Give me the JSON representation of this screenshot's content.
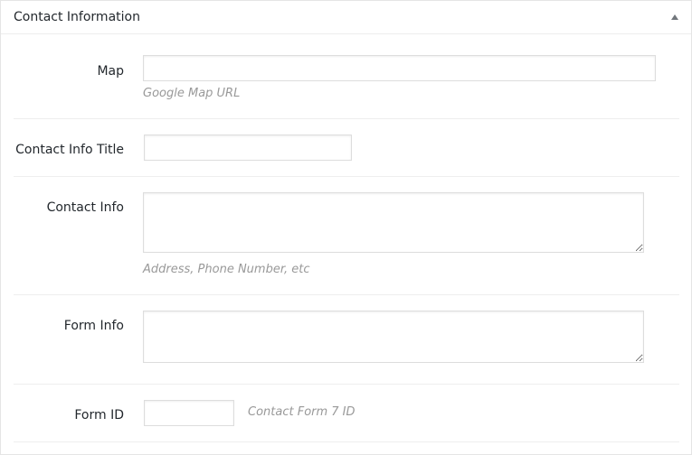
{
  "panel": {
    "title": "Contact Information"
  },
  "fields": {
    "map": {
      "label": "Map",
      "value": "",
      "description": "Google Map URL"
    },
    "contact_info_title": {
      "label": "Contact Info Title",
      "value": ""
    },
    "contact_info": {
      "label": "Contact Info",
      "value": "",
      "description": "Address, Phone Number, etc"
    },
    "form_info": {
      "label": "Form Info",
      "value": ""
    },
    "form_id": {
      "label": "Form ID",
      "value": "",
      "description": "Contact Form 7 ID"
    }
  },
  "icons": {
    "toggle": "triangle-up-icon"
  }
}
